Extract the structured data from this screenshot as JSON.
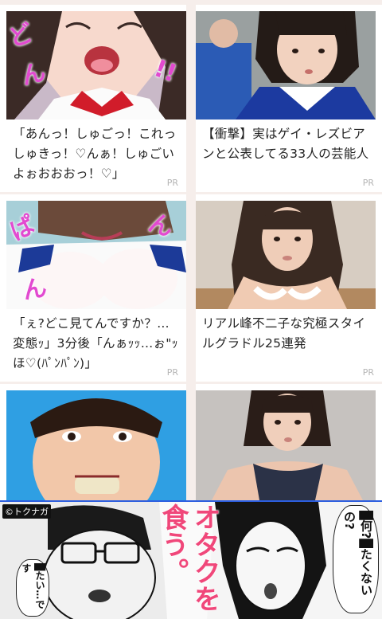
{
  "cards": [
    {
      "title": "「あんっ！しゅごっ！これっしゅきっ！♡んぁ！しゅごいよぉおおおっ！♡」",
      "pr": "PR",
      "image": "anime-illustration-thumbnail"
    },
    {
      "title": "【衝撃】実はゲイ・レズビアンと公表してる33人の芸能人",
      "pr": "PR",
      "image": "volleyball-player-photo"
    },
    {
      "title": "「ぇ?どこ見てんですか？…変態ｯ」3分後「んぁｯｯ…ぉ\"ｯほ♡(ﾊﾟﾝﾊﾟﾝ)」",
      "pr": "PR",
      "image": "anime-illustration-thumbnail"
    },
    {
      "title": "リアル峰不二子な究極スタイルグラドル25連発",
      "pr": "PR",
      "image": "gravure-model-photo"
    },
    {
      "title": "",
      "pr": "",
      "image": "face-closeup-photo"
    },
    {
      "title": "",
      "pr": "",
      "image": "gravure-model-photo"
    }
  ],
  "banner": {
    "copyright": "©トクナガ",
    "headline": "オタクを食う。",
    "bubble_right": "█何?█たくないの?",
    "bubble_left": "█たい…です"
  },
  "colors": {
    "background": "#f6eeeb",
    "banner_border": "#2c5fe0",
    "headline": "#f0477a"
  }
}
